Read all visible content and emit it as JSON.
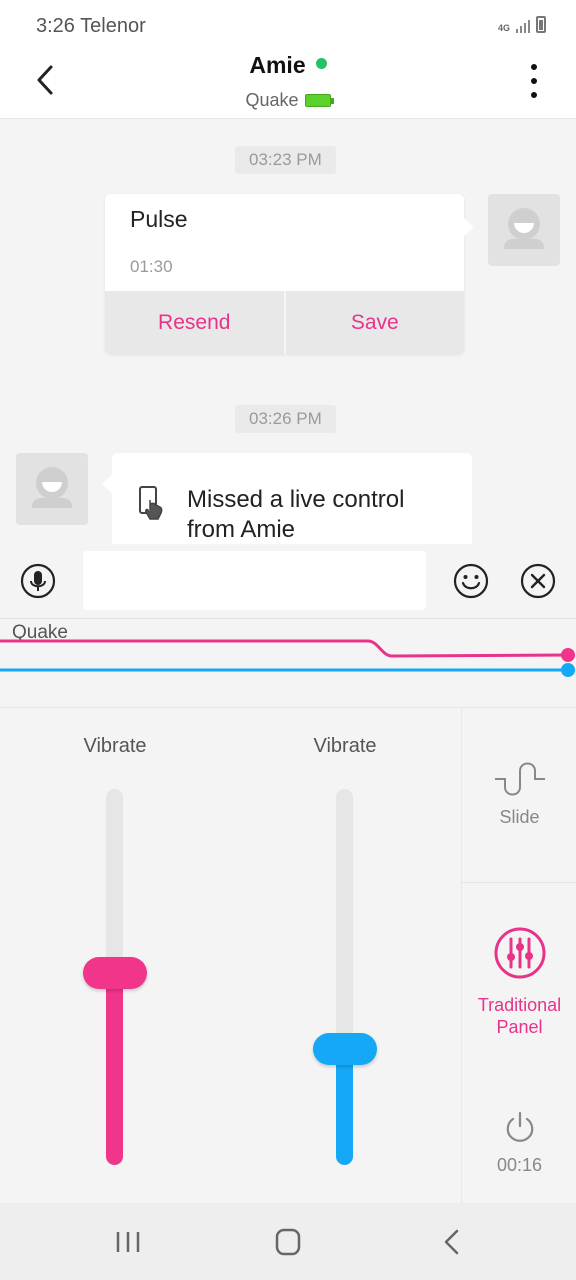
{
  "status_bar": {
    "time": "3:26",
    "carrier": "Telenor",
    "network": "4G"
  },
  "header": {
    "name": "Amie",
    "online": true,
    "device": "Quake",
    "battery": "full"
  },
  "messages": [
    {
      "type": "timestamp",
      "text": "03:23 PM"
    },
    {
      "type": "pattern",
      "title": "Pulse",
      "duration": "01:30",
      "actions": [
        "Resend",
        "Save"
      ]
    },
    {
      "type": "timestamp",
      "text": "03:26 PM"
    },
    {
      "type": "notice",
      "text": "Missed a live control from  Amie"
    }
  ],
  "input": {
    "placeholder": "",
    "value": ""
  },
  "graph": {
    "device_label": "Quake",
    "pink_level": 0.72,
    "blue_level": 0.5
  },
  "sliders": [
    {
      "label": "Vibrate",
      "value": 0.5,
      "color": "#f0358b"
    },
    {
      "label": "Vibrate",
      "value": 0.3,
      "color": "#14a8f7"
    }
  ],
  "side_panel": {
    "slide_label": "Slide",
    "traditional_label": "Traditional Panel",
    "timer": "00:16"
  },
  "colors": {
    "accent": "#e8338a",
    "blue": "#14a8f7",
    "online": "#24c16a"
  }
}
